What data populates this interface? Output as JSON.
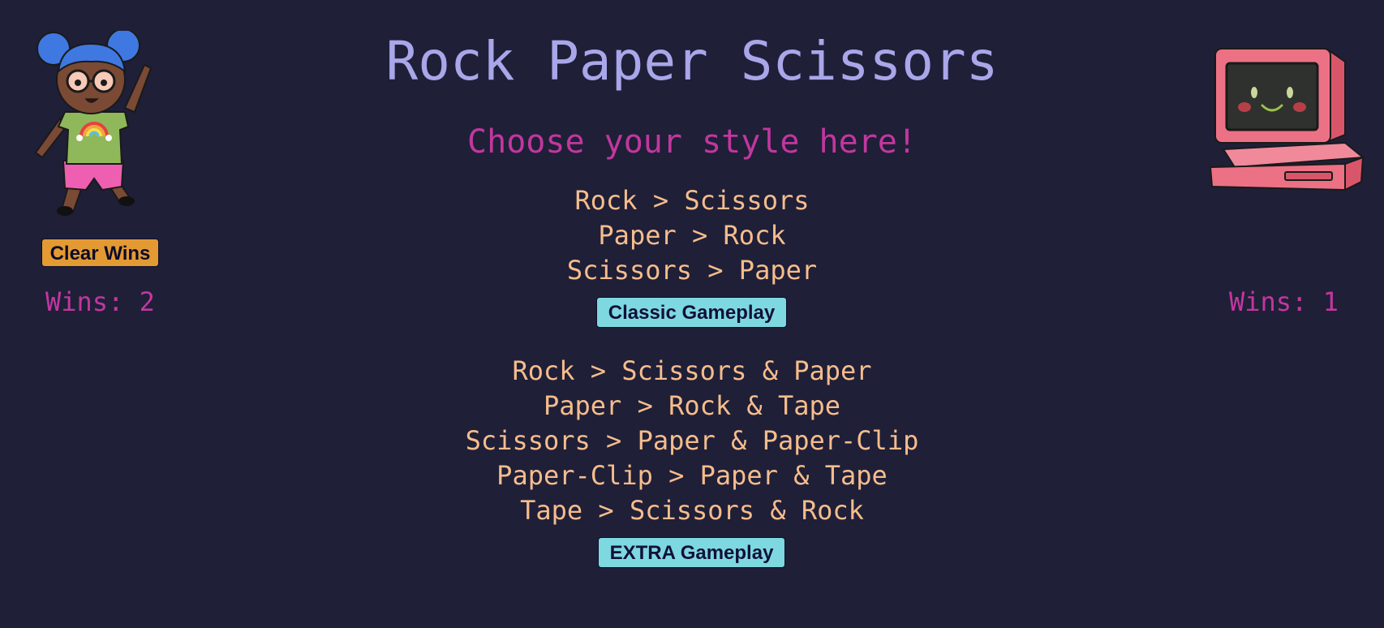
{
  "header": {
    "title": "Rock Paper Scissors",
    "subtitle": "Choose your style here!"
  },
  "classic": {
    "rules": [
      "Rock > Scissors",
      "Paper > Rock",
      "Scissors > Paper"
    ],
    "button_label": "Classic Gameplay"
  },
  "extra": {
    "rules": [
      "Rock > Scissors & Paper",
      "Paper > Rock & Tape",
      "Scissors > Paper & Paper-Clip",
      "Paper-Clip > Paper & Tape",
      "Tape > Scissors & Rock"
    ],
    "button_label": "EXTRA Gameplay"
  },
  "human": {
    "avatar_icon": "girl-avatar-icon",
    "clear_label": "Clear Wins",
    "wins_text": "Wins: 2"
  },
  "computer": {
    "avatar_icon": "computer-avatar-icon",
    "wins_text": "Wins: 1"
  },
  "colors": {
    "background": "#1f1f38",
    "title": "#a9a6e9",
    "accent": "#c2379e",
    "rules": "#f6bd8c",
    "mode_button": "#7ed8df",
    "clear_button": "#e39a33"
  }
}
